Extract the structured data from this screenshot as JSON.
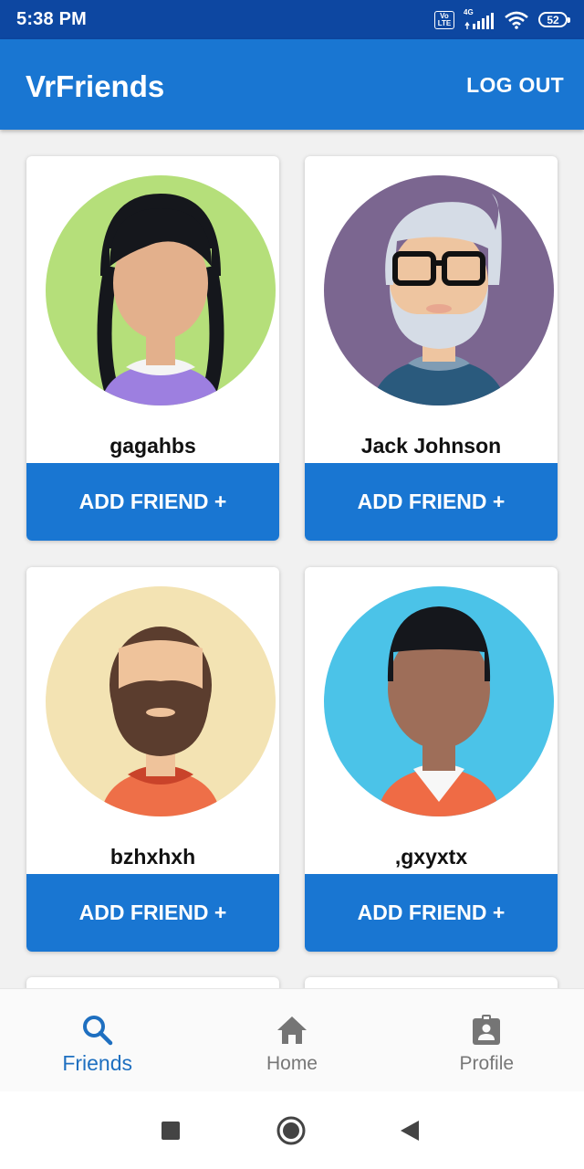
{
  "status_bar": {
    "time": "5:38 PM",
    "volte_badge": "Vo LTE",
    "network": "4G",
    "battery": "52"
  },
  "app_bar": {
    "title": "VrFriends",
    "logout_label": "LOG OUT"
  },
  "friends": [
    {
      "name": "gagahbs",
      "button_label": "ADD FRIEND +",
      "avatar": "girl-braids-avatar"
    },
    {
      "name": "Jack Johnson",
      "button_label": "ADD FRIEND +",
      "avatar": "old-man-glasses-avatar"
    },
    {
      "name": "bzhxhxh",
      "button_label": "ADD FRIEND +",
      "avatar": "bearded-man-avatar"
    },
    {
      "name": ",gxyxtx",
      "button_label": "ADD FRIEND +",
      "avatar": "dark-skin-man-avatar"
    }
  ],
  "bottom_nav": {
    "items": [
      {
        "label": "Friends",
        "icon": "search-icon",
        "active": true
      },
      {
        "label": "Home",
        "icon": "home-icon",
        "active": false
      },
      {
        "label": "Profile",
        "icon": "profile-badge-icon",
        "active": false
      }
    ]
  },
  "colors": {
    "primary": "#1976d2",
    "status_bar": "#0d47a1",
    "active_nav": "#1e6fc0"
  }
}
